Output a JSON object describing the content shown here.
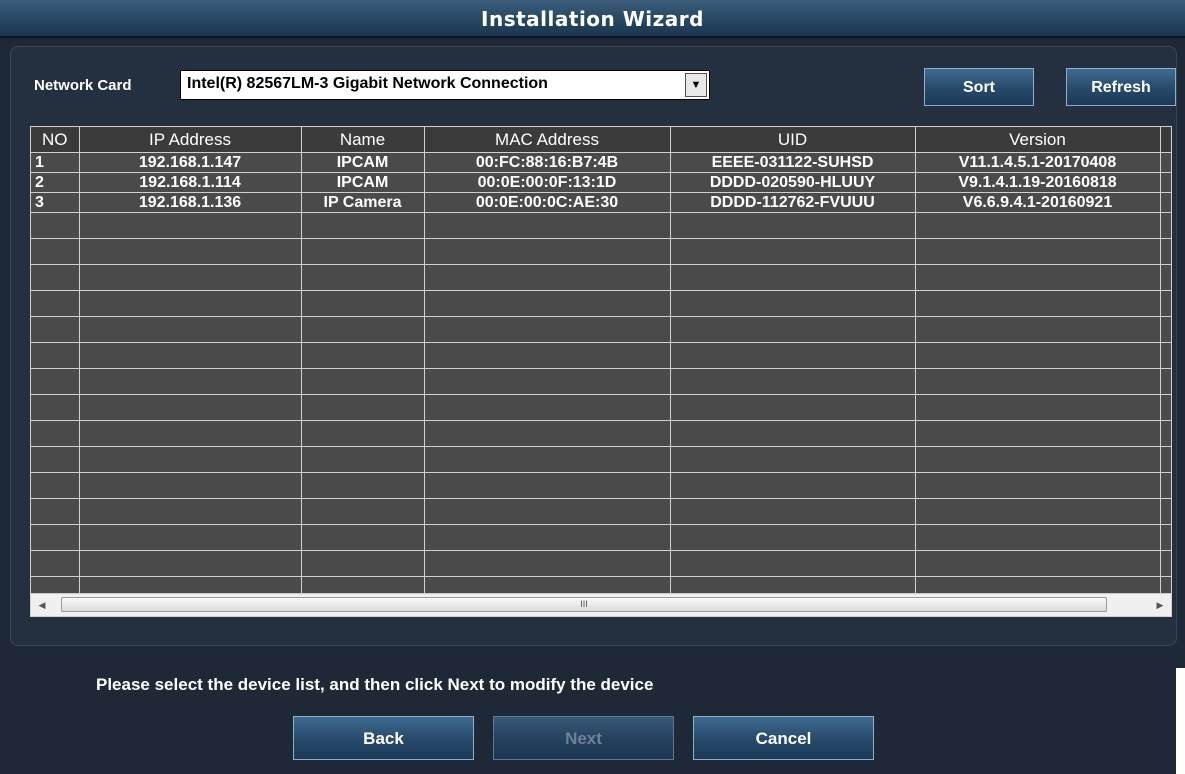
{
  "window": {
    "title": "Installation Wizard"
  },
  "network_card": {
    "label": "Network Card",
    "selected": "Intel(R) 82567LM-3 Gigabit Network Connection"
  },
  "toolbar": {
    "sort_label": "Sort",
    "refresh_label": "Refresh"
  },
  "table": {
    "headers": [
      "NO",
      "IP Address",
      "Name",
      "MAC Address",
      "UID",
      "Version"
    ],
    "rows": [
      [
        "1",
        "192.168.1.147",
        "IPCAM",
        "00:FC:88:16:B7:4B",
        "EEEE-031122-SUHSD",
        "V11.1.4.5.1-20170408"
      ],
      [
        "2",
        "192.168.1.114",
        "IPCAM",
        "00:0E:00:0F:13:1D",
        "DDDD-020590-HLUUY",
        "V9.1.4.1.19-20160818"
      ],
      [
        "3",
        "192.168.1.136",
        "IP Camera",
        "00:0E:00:0C:AE:30",
        "DDDD-112762-FVUUU",
        "V6.6.9.4.1-20160921"
      ]
    ]
  },
  "scrollbar": {
    "thumb_grip": "III"
  },
  "hint": "Please select the device list, and then click Next to modify the device",
  "footer": {
    "back_label": "Back",
    "next_label": "Next",
    "cancel_label": "Cancel"
  },
  "icons": {
    "dropdown": "chevron-down-icon",
    "scroll_left": "arrow-left-icon",
    "scroll_right": "arrow-right-icon"
  },
  "colors": {
    "window_bg": "#1e2836",
    "title_bar": "#2a4a66",
    "button_blue": "#26496a",
    "grid_bg": "#4a4a4a",
    "grid_lines": "#d0d0d0",
    "disabled_text": "#6e8296"
  }
}
